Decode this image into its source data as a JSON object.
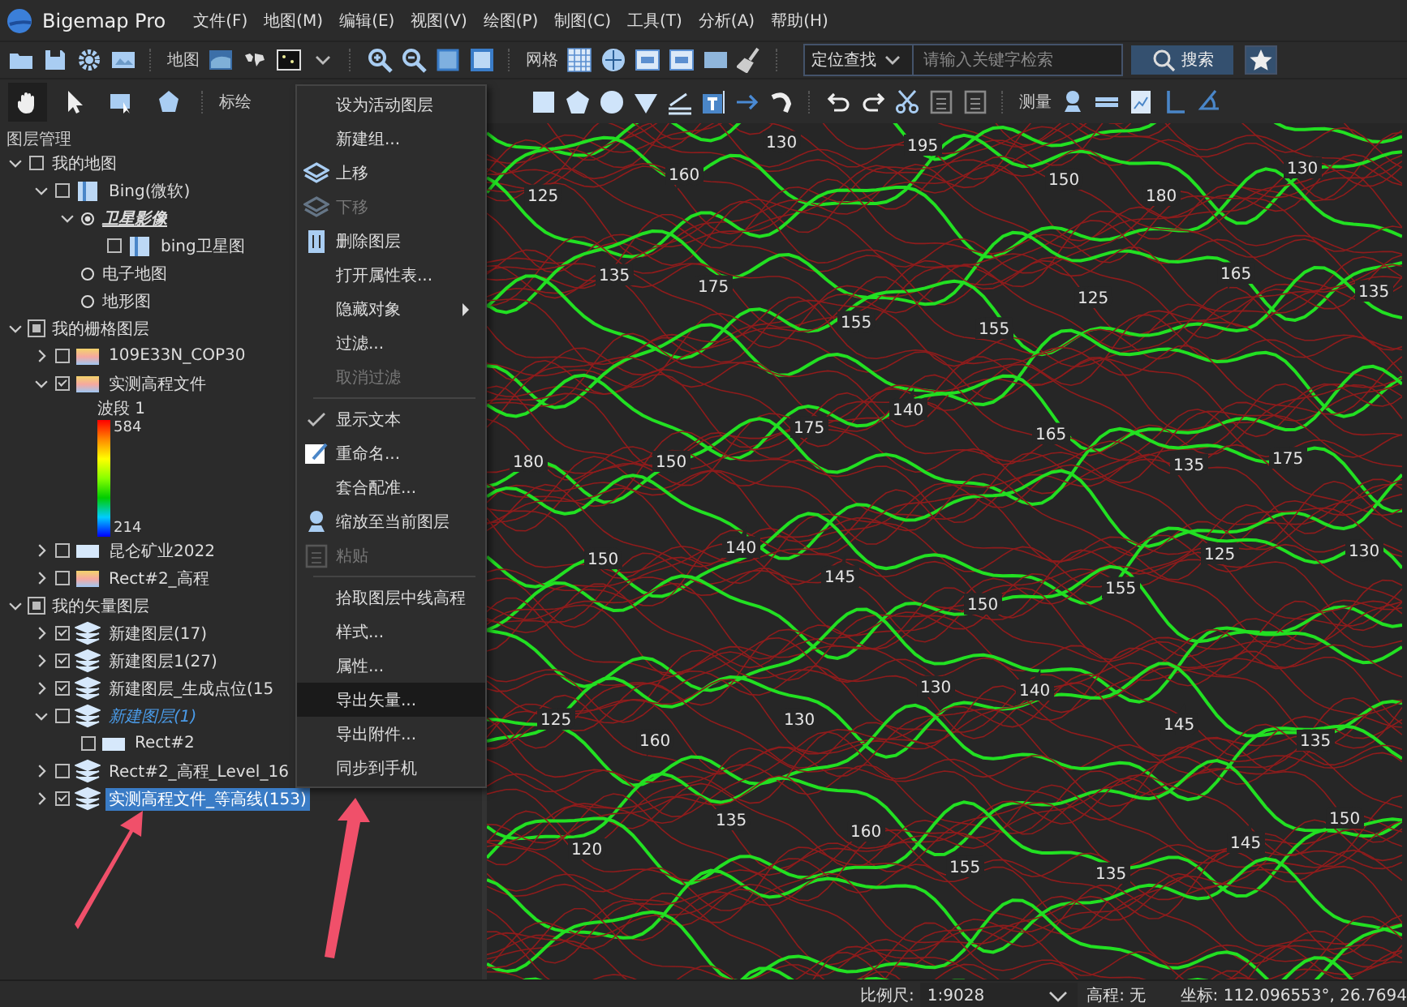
{
  "window": {
    "title": "Bigemap Pro"
  },
  "menu_bar": [
    "文件(F)",
    "地图(M)",
    "编辑(E)",
    "视图(V)",
    "绘图(P)",
    "制图(C)",
    "工具(T)",
    "分析(A)",
    "帮助(H)"
  ],
  "toolbar_1": {
    "map_label": "地图",
    "grid_label": "网格",
    "search": {
      "mode": "定位查找",
      "placeholder": "请输入关键字检索",
      "button": "搜索"
    }
  },
  "toolbar_2": {
    "tools": [
      {
        "selected": true
      },
      {
        "selected": false
      },
      {
        "selected": false
      },
      {
        "selected": false
      }
    ],
    "draw_label": "标绘",
    "measure_label": "测量"
  },
  "layer_panel": {
    "title": "图层管理",
    "layers": [
      {
        "label": "我的地图",
        "kind": "group",
        "expanded": true,
        "indeterminate": false,
        "children": [
          {
            "label": "Bing(微软)",
            "kind": "map",
            "expanded": true,
            "checked": false,
            "children": [
              {
                "label": "卫星影像",
                "kind": "radio",
                "expanded": true,
                "selected": true,
                "emphasized": true,
                "children": [
                  {
                    "label": "bing卫星图",
                    "kind": "map",
                    "checked": false
                  }
                ]
              },
              {
                "label": "电子地图",
                "kind": "radio",
                "selected": false
              },
              {
                "label": "地形图",
                "kind": "radio",
                "selected": false
              }
            ]
          }
        ]
      },
      {
        "label": "我的栅格图层",
        "kind": "group",
        "expanded": true,
        "indeterminate": true,
        "children": [
          {
            "label": "109E33N_COP30",
            "kind": "raster",
            "expanded": false,
            "checked": false
          },
          {
            "label": "实测高程文件",
            "kind": "raster",
            "expanded": true,
            "checked": true,
            "legend": {
              "title": "波段 1",
              "max": "584",
              "min": "214"
            }
          },
          {
            "label": "昆仑矿业2022",
            "kind": "image",
            "expanded": false,
            "checked": false
          },
          {
            "label": "Rect#2_高程",
            "kind": "raster",
            "expanded": false,
            "checked": false
          }
        ]
      },
      {
        "label": "我的矢量图层",
        "kind": "group",
        "expanded": true,
        "indeterminate": true,
        "children": [
          {
            "label": "新建图层(17)",
            "kind": "vector",
            "expanded": false,
            "checked": true
          },
          {
            "label": "新建图层1(27)",
            "kind": "vector",
            "expanded": false,
            "checked": true
          },
          {
            "label": "新建图层_生成点位(15",
            "kind": "vector",
            "expanded": false,
            "checked": true
          },
          {
            "label": "新建图层(1)",
            "kind": "vector",
            "expanded": true,
            "checked": false,
            "active": true,
            "children": [
              {
                "label": "Rect#2",
                "kind": "rect",
                "checked": false
              }
            ]
          },
          {
            "label": "Rect#2_高程_Level_16",
            "kind": "vector",
            "expanded": false,
            "checked": false
          },
          {
            "label": "实测高程文件_等高线(153)",
            "kind": "vector",
            "expanded": false,
            "checked": true,
            "selected": true
          }
        ]
      }
    ]
  },
  "context_menu": [
    {
      "label": "设为活动图层",
      "kind": "plain",
      "disabled": false,
      "selected": false
    },
    {
      "label": "新建组...",
      "kind": "plain",
      "disabled": false,
      "selected": false
    },
    {
      "label": "上移",
      "kind": "move-up",
      "disabled": false,
      "selected": false
    },
    {
      "label": "下移",
      "kind": "move-down",
      "disabled": true,
      "selected": false
    },
    {
      "label": "删除图层",
      "kind": "delete",
      "disabled": false,
      "selected": false
    },
    {
      "label": "打开属性表...",
      "kind": "plain",
      "disabled": false,
      "selected": false
    },
    {
      "label": "隐藏对象",
      "kind": "submenu",
      "disabled": false,
      "selected": false
    },
    {
      "label": "过滤...",
      "kind": "plain",
      "disabled": false,
      "selected": false
    },
    {
      "label": "取消过滤",
      "kind": "plain",
      "disabled": true,
      "selected": false
    },
    {
      "kind": "separator"
    },
    {
      "label": "显示文本",
      "kind": "check",
      "checked": true,
      "disabled": false,
      "selected": false
    },
    {
      "label": "重命名...",
      "kind": "rename",
      "disabled": false,
      "selected": false
    },
    {
      "label": "套合配准...",
      "kind": "plain",
      "disabled": false,
      "selected": false
    },
    {
      "label": "缩放至当前图层",
      "kind": "zoom",
      "disabled": false,
      "selected": false
    },
    {
      "label": "粘贴",
      "kind": "paste",
      "disabled": true,
      "selected": false
    },
    {
      "kind": "separator"
    },
    {
      "label": "拾取图层中线高程",
      "kind": "plain",
      "disabled": false,
      "selected": false
    },
    {
      "label": "样式...",
      "kind": "plain",
      "disabled": false,
      "selected": false
    },
    {
      "label": "属性...",
      "kind": "plain",
      "disabled": false,
      "selected": false
    },
    {
      "label": "导出矢量...",
      "kind": "plain",
      "disabled": false,
      "selected": true
    },
    {
      "label": "导出附件...",
      "kind": "plain",
      "disabled": false,
      "selected": false
    },
    {
      "label": "同步到手机",
      "kind": "plain",
      "disabled": false,
      "selected": false
    }
  ],
  "map": {
    "contour_labels": [
      "125",
      "160",
      "130",
      "195",
      "150",
      "180",
      "130",
      "135",
      "175",
      "155",
      "155",
      "125",
      "165",
      "135",
      "180",
      "150",
      "175",
      "140",
      "165",
      "135",
      "175",
      "150",
      "140",
      "145",
      "150",
      "155",
      "125",
      "130",
      "125",
      "160",
      "130",
      "130",
      "140",
      "145",
      "135",
      "120",
      "135",
      "160",
      "155",
      "135",
      "145",
      "150"
    ]
  },
  "status_bar": {
    "scale_label": "比例尺:",
    "scale_value": "1:9028",
    "elevation": "高程: 无",
    "coordinates": "坐标: 112.096553°, 26.7694"
  }
}
